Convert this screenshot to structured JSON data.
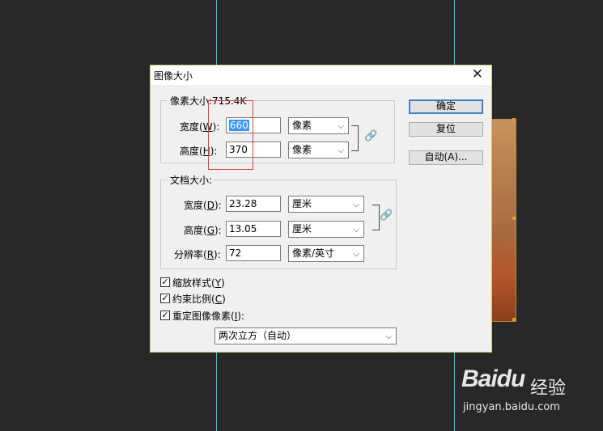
{
  "dialog": {
    "title": "图像大小",
    "close": "✕"
  },
  "pixel_dims": {
    "legend": "像素大小:715.4K",
    "width_label": "宽度(",
    "width_key": "W",
    "width_value": "660",
    "width_unit": "像素",
    "height_label": "高度(",
    "height_key": "H",
    "height_value": "370",
    "height_unit": "像素"
  },
  "doc_size": {
    "legend": "文档大小:",
    "width_label": "宽度(",
    "width_key": "D",
    "width_value": "23.28",
    "width_unit": "厘米",
    "height_label": "高度(",
    "height_key": "G",
    "height_value": "13.05",
    "height_unit": "厘米",
    "res_label": "分辨率(",
    "res_key": "R",
    "res_value": "72",
    "res_unit": "像素/英寸"
  },
  "suffix": "):",
  "buttons": {
    "ok": "确定",
    "reset": "复位",
    "auto": "自动(A)..."
  },
  "options": {
    "scale_styles": "缩放样式(",
    "scale_styles_key": "Y",
    "constrain": "约束比例(",
    "constrain_key": "C",
    "resample": "重定图像像素(",
    "resample_key": "I",
    "resample_suffix": "):",
    "close_paren": ")",
    "method": "两次立方（自动）"
  },
  "watermark": {
    "logo": "Baidu",
    "text": "经验",
    "url": "jingyan.baidu.com"
  }
}
